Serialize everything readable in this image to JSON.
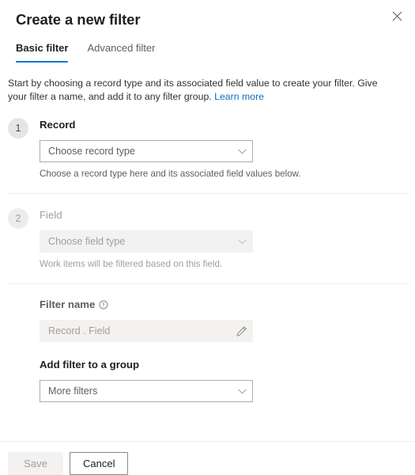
{
  "header": {
    "title": "Create a new filter",
    "close_label": "Close"
  },
  "tabs": [
    {
      "label": "Basic filter",
      "active": true
    },
    {
      "label": "Advanced filter",
      "active": false
    }
  ],
  "intro": {
    "text": "Start by choosing a record type and its associated field value to create your filter. Give your filter a name, and add it to any filter group.",
    "link_label": "Learn more"
  },
  "steps": [
    {
      "badge": "1",
      "label": "Record",
      "dropdown_value": "Choose record type",
      "hint": "Choose a record type here and its associated field values below.",
      "disabled": false
    },
    {
      "badge": "2",
      "label": "Field",
      "dropdown_value": "Choose field type",
      "hint": "Work items will be filtered based on this field.",
      "disabled": true
    }
  ],
  "filter_name": {
    "label": "Filter name",
    "info_tooltip": "Filter name info",
    "value": "Record . Field",
    "edit_label": "Edit"
  },
  "filter_group": {
    "label": "Add filter to a group",
    "selected": "More filters"
  },
  "footer": {
    "save_label": "Save",
    "cancel_label": "Cancel"
  },
  "colors": {
    "accent": "#0078d4",
    "link": "#0f6cbd",
    "text": "#323130",
    "disabled_text": "#a19f9d",
    "field_bg": "#f3f2f1",
    "border": "#adacab"
  }
}
